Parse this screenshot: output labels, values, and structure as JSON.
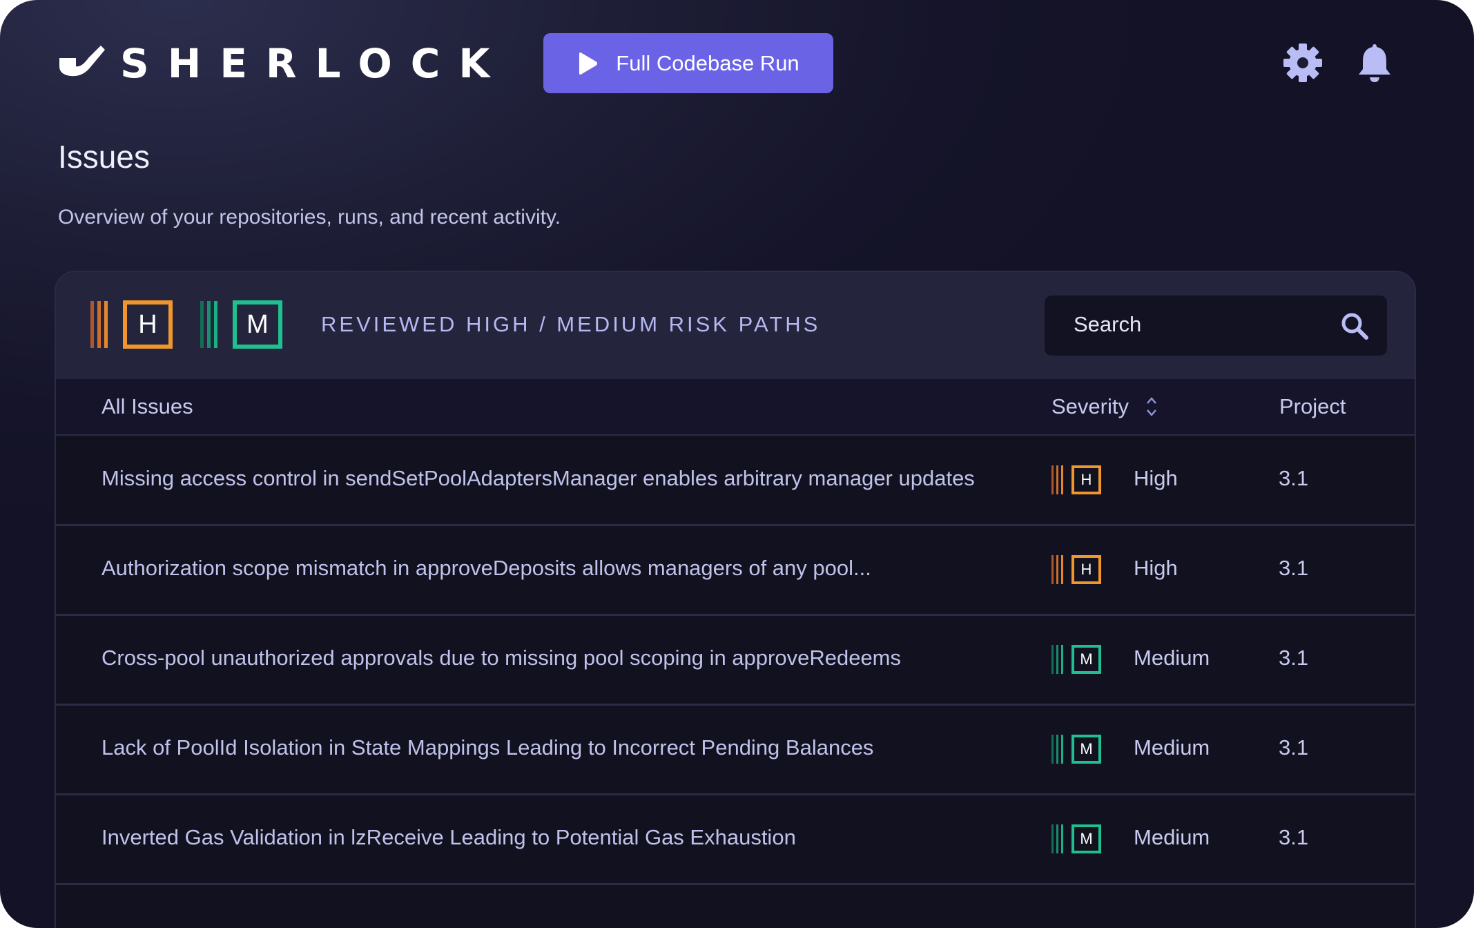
{
  "app": {
    "brand": "SHERLOCK",
    "run_button": "Full Codebase Run",
    "icons": {
      "settings": "gear-icon",
      "notifications": "bell-icon",
      "play": "play-icon",
      "search": "search-icon"
    }
  },
  "page": {
    "title": "Issues",
    "subtitle": "Overview of your repositories, runs, and recent activity."
  },
  "card": {
    "heading": "REVIEWED HIGH / MEDIUM RISK PATHS",
    "badges": [
      "H",
      "M"
    ],
    "search_placeholder": "Search"
  },
  "table": {
    "columns": {
      "issues": "All Issues",
      "severity": "Severity",
      "project": "Project"
    },
    "rows": [
      {
        "title": "Missing access control in sendSetPoolAdaptersManager enables arbitrary manager updates",
        "badge": "H",
        "severity": "High",
        "project": "3.1"
      },
      {
        "title": "Authorization scope mismatch in approveDeposits allows managers of any pool...",
        "badge": "H",
        "severity": "High",
        "project": "3.1"
      },
      {
        "title": "Cross-pool unauthorized approvals due to missing pool scoping in approveRedeems",
        "badge": "M",
        "severity": "Medium",
        "project": "3.1"
      },
      {
        "title": "Lack of PoolId Isolation in State Mappings Leading to Incorrect Pending Balances",
        "badge": "M",
        "severity": "Medium",
        "project": "3.1"
      },
      {
        "title": "Inverted Gas Validation in lzReceive Leading to Potential Gas Exhaustion",
        "badge": "M",
        "severity": "Medium",
        "project": "3.1"
      }
    ]
  },
  "colors": {
    "accent": "#6a63e6",
    "high": "#f0962c",
    "medium": "#1fbf8f",
    "heading": "#b6b8f2"
  }
}
